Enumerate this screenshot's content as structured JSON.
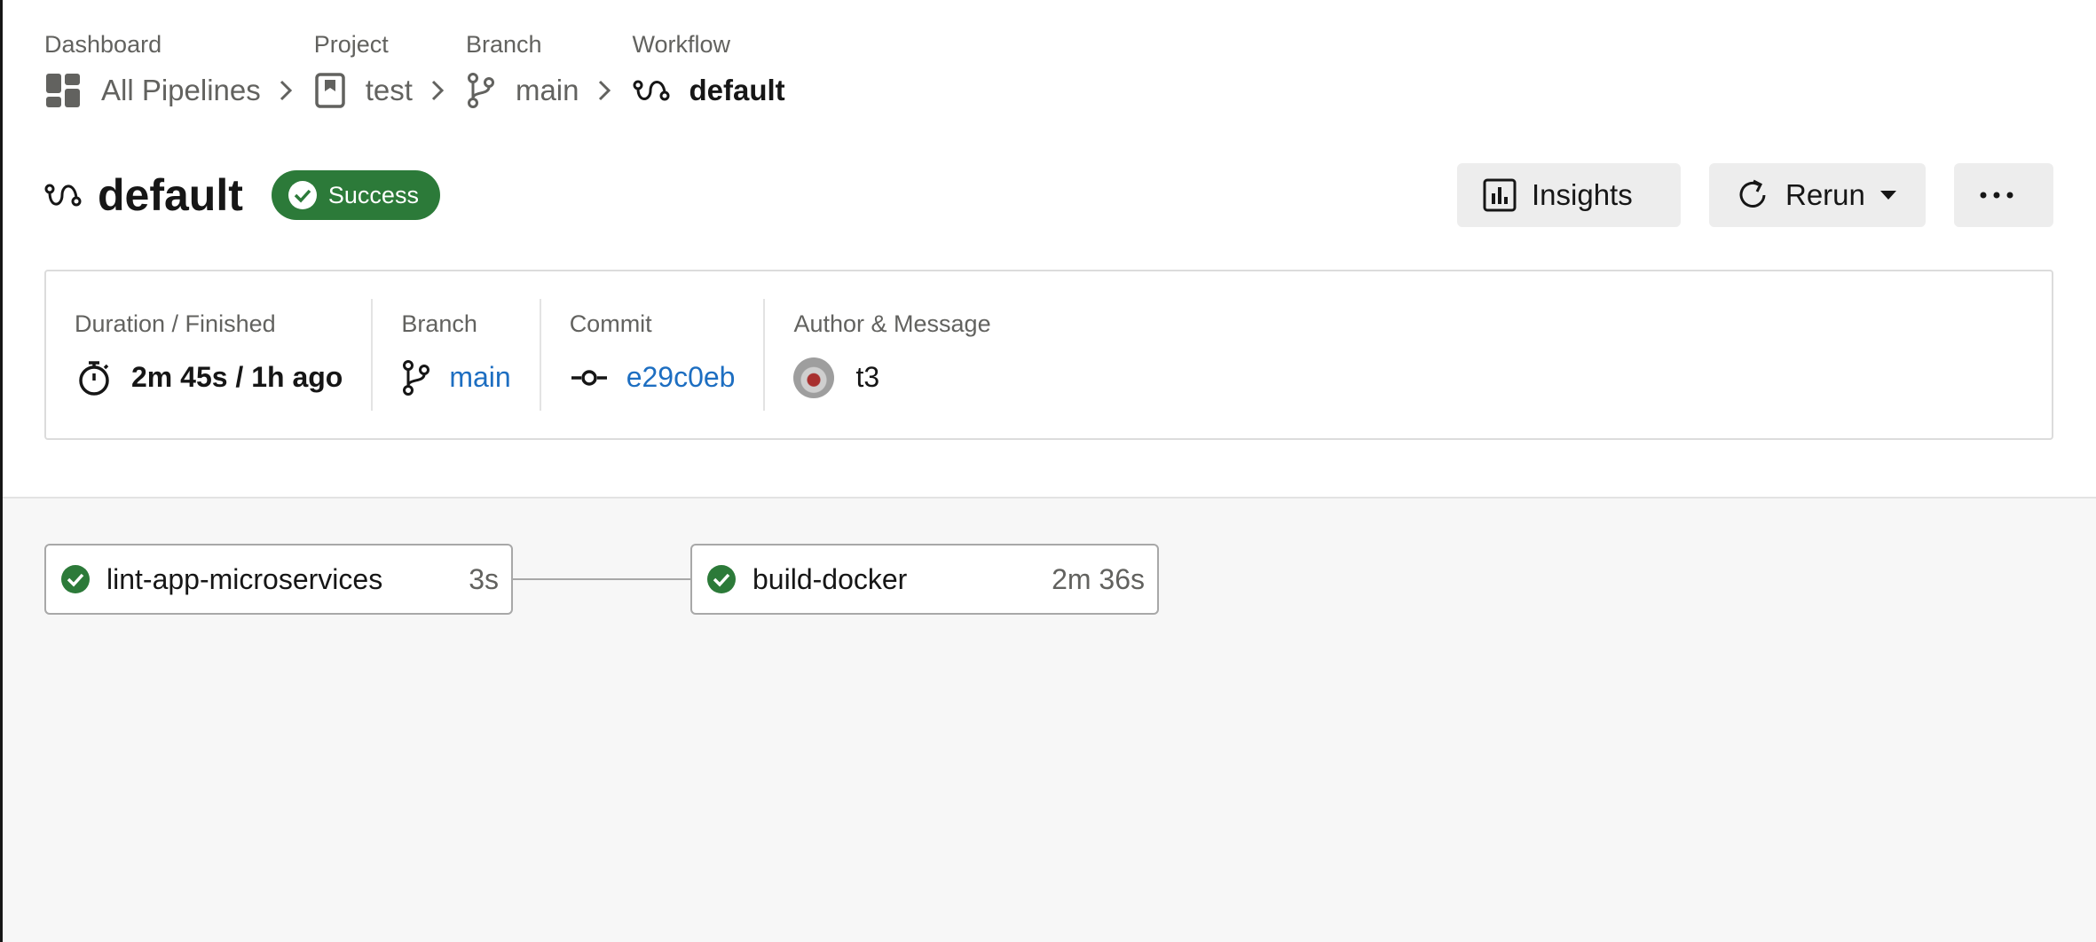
{
  "breadcrumb": [
    {
      "category": "Dashboard",
      "label": "All Pipelines",
      "icon": "dashboard-icon"
    },
    {
      "category": "Project",
      "label": "test",
      "icon": "project-icon"
    },
    {
      "category": "Branch",
      "label": "main",
      "icon": "branch-icon"
    },
    {
      "category": "Workflow",
      "label": "default",
      "icon": "workflow-icon"
    }
  ],
  "header": {
    "title": "default",
    "status": "Success",
    "status_color": "#2c7a39",
    "buttons": {
      "insights": "Insights",
      "rerun": "Rerun",
      "more": "more-icon"
    }
  },
  "info": {
    "duration_label": "Duration / Finished",
    "duration_value": "2m 45s / 1h ago",
    "branch_label": "Branch",
    "branch_value": "main",
    "commit_label": "Commit",
    "commit_value": "e29c0eb",
    "author_label": "Author & Message",
    "author_value": "t3"
  },
  "jobs": [
    {
      "name": "lint-app-microservices",
      "duration": "3s",
      "status": "success"
    },
    {
      "name": "build-docker",
      "duration": "2m 36s",
      "status": "success"
    }
  ],
  "colors": {
    "link": "#1d6ec1",
    "success": "#2c7a39"
  }
}
